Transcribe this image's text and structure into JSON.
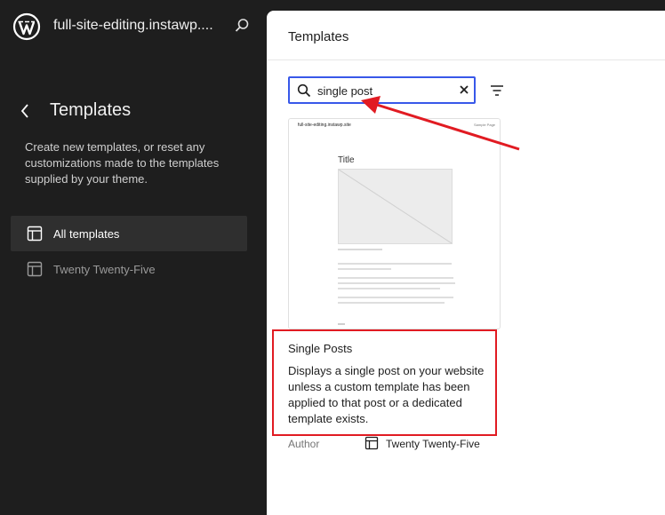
{
  "topbar": {
    "site_title": "full-site-editing.instawp....",
    "logo_icon": "wordpress-logo-icon",
    "search_icon": "search-icon"
  },
  "sidebar": {
    "heading": "Templates",
    "description": "Create new templates, or reset any customizations made to the templates supplied by your theme.",
    "items": [
      {
        "label": "All templates",
        "icon": "layout-icon",
        "active": true
      },
      {
        "label": "Twenty Twenty-Five",
        "icon": "layout-icon",
        "active": false
      }
    ]
  },
  "main": {
    "title": "Templates",
    "search": {
      "value": "single post",
      "placeholder": "Search"
    },
    "template": {
      "title": "Single Posts",
      "description": "Displays a single post on your website unless a custom template has been applied to that post or a dedicated template exists.",
      "author_label": "Author",
      "author_value": "Twenty Twenty-Five",
      "preview": {
        "site": "full-site-editing.instawp.site",
        "page": "Sample Page",
        "heading": "Title"
      }
    }
  },
  "colors": {
    "sidebar_bg": "#1e1e1e",
    "accent": "#3858e9",
    "annotation": "#e11b22"
  }
}
